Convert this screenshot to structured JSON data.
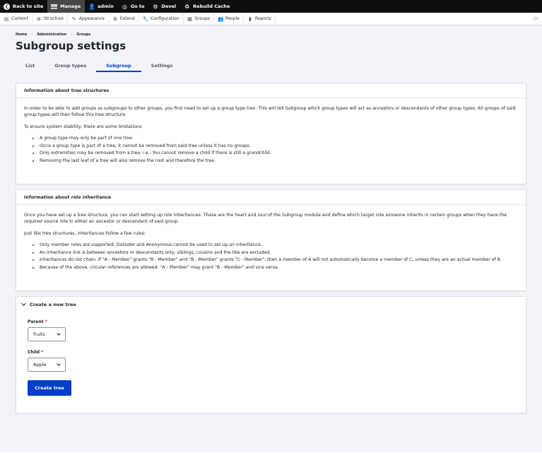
{
  "toolbar": {
    "items": [
      {
        "label": "Back to site",
        "icon": "back-arrow-icon"
      },
      {
        "label": "Manage",
        "icon": "hamburger-icon"
      },
      {
        "label": "admin",
        "icon": "user-icon"
      },
      {
        "label": "Go to",
        "icon": "goto-icon"
      },
      {
        "label": "Devel",
        "icon": "gear-icon"
      },
      {
        "label": "Rebuild Cache",
        "icon": "refresh-icon"
      }
    ]
  },
  "tray": {
    "items": [
      {
        "label": "Content",
        "icon": "content-icon"
      },
      {
        "label": "Structure",
        "icon": "structure-icon"
      },
      {
        "label": "Appearance",
        "icon": "appearance-icon"
      },
      {
        "label": "Extend",
        "icon": "extend-icon"
      },
      {
        "label": "Configuration",
        "icon": "wrench-icon"
      },
      {
        "label": "Groups",
        "icon": "groups-icon"
      },
      {
        "label": "People",
        "icon": "people-icon"
      },
      {
        "label": "Reports",
        "icon": "reports-icon"
      }
    ]
  },
  "breadcrumb": [
    "Home",
    "Administration",
    "Groups"
  ],
  "page_title": "Subgroup settings",
  "tabs": [
    {
      "label": "List"
    },
    {
      "label": "Group types"
    },
    {
      "label": "Subgroup"
    },
    {
      "label": "Settings"
    }
  ],
  "panel_tree": {
    "title": "Information about tree structures",
    "p1": "In order to be able to add groups as subgroups to other groups, you first need to set up a group type tree. This will tell Subgroup which group types will act as ancestors or descendants of other group types. All groups of said group types will then follow this tree structure.",
    "p2": "To ensure system stability, there are some limitations:",
    "list": [
      "A group type may only be part of one tree.",
      "Once a group type is part of a tree, it cannot be removed from said tree unless it has no groups.",
      "Only extremities may be removed from a tree, i.e.: You cannot remove a child if there is still a grandchild.",
      "Removing the last leaf of a tree will also remove the root and therefore the tree."
    ]
  },
  "panel_role": {
    "title": "Information about role inheritance",
    "p1": "Once you have set up a tree structure, you can start setting up role inheritances. These are the heart and soul of the Subgroup module and define which target role someone inherits in certain groups when they have the required source role in either an ancestor or descendant of said group.",
    "p2": "Just like tree structures, inheritances follow a few rules:",
    "list": [
      "Only member roles are supported; Outsider and Anonymous cannot be used to set up an inheritance.",
      "An inheritance link is between ancestors or descendants only; siblings, cousins and the like are excluded.",
      "Inheritances do not chain: If \"A - Member\" grants \"B - Member\" and \"B - Member\" grants \"C - Member\", then a member of A will not automatically become a member of C, unless they are an actual member of B.",
      "Because of the above, circular references are allowed: \"A - Member\" may grant \"B - Member\" and vice versa."
    ]
  },
  "create_tree": {
    "summary": "Create a new tree",
    "parent_label": "Parent",
    "parent_value": "fruits",
    "child_label": "Child",
    "child_value": "Apple",
    "required_mark": "*",
    "button_label": "Create tree"
  },
  "colors": {
    "accent": "#003ecc",
    "required": "#d72222",
    "toolbar": "#0f0f0f"
  }
}
